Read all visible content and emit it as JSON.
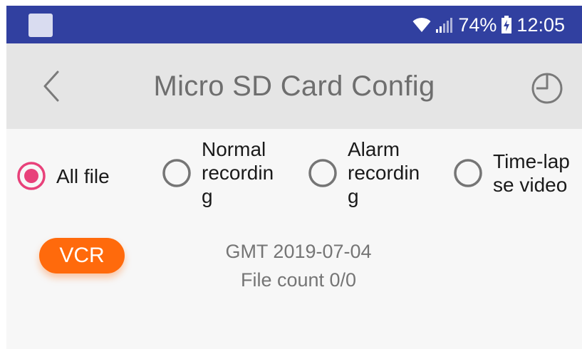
{
  "status_bar": {
    "battery": "74%",
    "time": "12:05",
    "icons": [
      "app-icon",
      "wifi-icon",
      "signal-icon",
      "battery-charging-icon"
    ]
  },
  "toolbar": {
    "title": "Micro SD Card Config",
    "back_icon": "chevron-left-icon",
    "history_icon": "history-clock-icon"
  },
  "filters": {
    "selected": "all",
    "options": [
      {
        "id": "all",
        "label": "All file"
      },
      {
        "id": "normal",
        "label": "Normal\nrecordin\ng"
      },
      {
        "id": "alarm",
        "label": "Alarm\nrecordin\ng"
      },
      {
        "id": "timelapse",
        "label": "Time-lap\nse video"
      }
    ]
  },
  "content": {
    "vcr_label": "VCR",
    "date_text": "GMT 2019-07-04",
    "file_count_text": "File count 0/0"
  },
  "colors": {
    "status_bar": "#3140a0",
    "toolbar": "#e5e5e5",
    "accent_radio": "#e8417a",
    "vcr_button": "#ff6a0c",
    "radio_unselected": "#757575"
  }
}
